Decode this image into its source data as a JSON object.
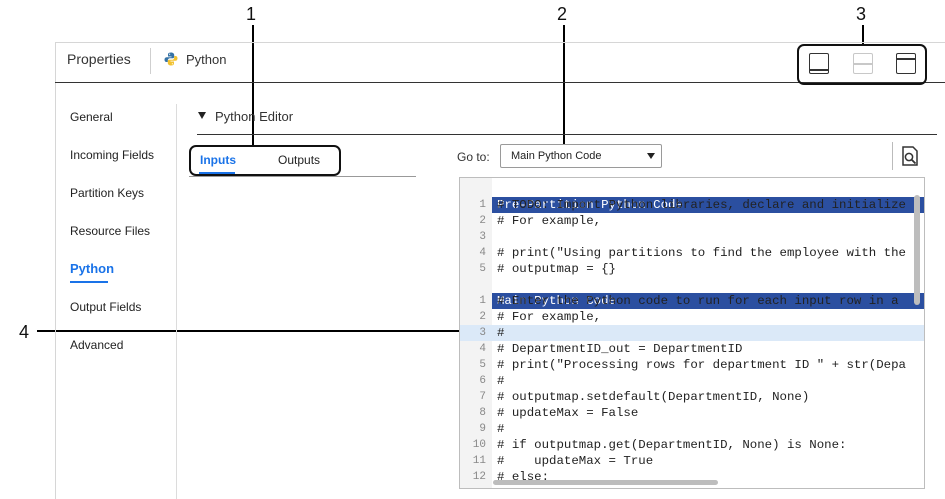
{
  "callouts": [
    "1",
    "2",
    "3",
    "4"
  ],
  "header": {
    "title": "Properties",
    "python_label": "Python"
  },
  "view_buttons": [
    "layout-bottom-panel-icon",
    "layout-split-icon",
    "layout-top-panel-icon"
  ],
  "sidebar": {
    "items": [
      {
        "label": "General"
      },
      {
        "label": "Incoming Fields"
      },
      {
        "label": "Partition Keys"
      },
      {
        "label": "Resource Files"
      },
      {
        "label": "Python",
        "active": true
      },
      {
        "label": "Output Fields"
      },
      {
        "label": "Advanced"
      }
    ]
  },
  "editor": {
    "title": "Python Editor",
    "tabs": [
      {
        "label": "Inputs",
        "active": true
      },
      {
        "label": "Outputs"
      }
    ],
    "goto_label": "Go to:",
    "goto_value": "Main Python Code"
  },
  "code": {
    "pre_partition_header": "Pre-Partition Python Code",
    "pre_partition_lines": [
      {
        "n": "1",
        "text": "# TODO: Import Python libraries, declare and initialize"
      },
      {
        "n": "2",
        "text": "# For example,"
      },
      {
        "n": "3",
        "text": ""
      },
      {
        "n": "4",
        "text": "# print(\"Using partitions to find the employee with the"
      },
      {
        "n": "5",
        "text": "# outputmap = {}"
      }
    ],
    "main_header": "Main Python Code",
    "main_lines": [
      {
        "n": "1",
        "text": "# Enter the Python code to run for each input row in a"
      },
      {
        "n": "2",
        "text": "# For example,"
      },
      {
        "n": "3",
        "text": "#"
      },
      {
        "n": "4",
        "text": "# DepartmentID_out = DepartmentID"
      },
      {
        "n": "5",
        "text": "# print(\"Processing rows for department ID \" + str(Depa"
      },
      {
        "n": "6",
        "text": "#"
      },
      {
        "n": "7",
        "text": "# outputmap.setdefault(DepartmentID, None)"
      },
      {
        "n": "8",
        "text": "# updateMax = False"
      },
      {
        "n": "9",
        "text": "#"
      },
      {
        "n": "10",
        "text": "# if outputmap.get(DepartmentID, None) is None:"
      },
      {
        "n": "11",
        "text": "#    updateMax = True"
      },
      {
        "n": "12",
        "text": "# else:"
      }
    ]
  },
  "colors": {
    "accent": "#1a73e8",
    "code_header": "#2b4fa0",
    "highlight_row": "#dbe9f8"
  }
}
